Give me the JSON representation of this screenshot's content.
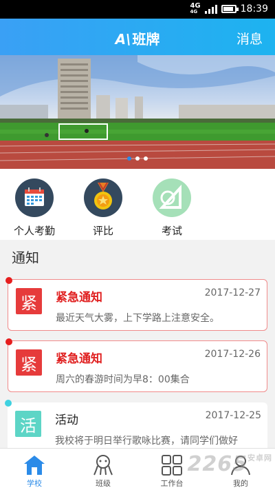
{
  "status_bar": {
    "network": "4G",
    "network_sub": "4G",
    "time": "18:39"
  },
  "header": {
    "logo": "A\\",
    "title": "班牌",
    "messages_label": "消息"
  },
  "banner": {
    "slide_count": 3,
    "active_slide": 1
  },
  "menu": [
    {
      "label": "个人考勤",
      "icon": "calendar-icon"
    },
    {
      "label": "评比",
      "icon": "medal-icon"
    },
    {
      "label": "考试",
      "icon": "ruler-icon"
    }
  ],
  "notices_section": {
    "title": "通知"
  },
  "notices": [
    {
      "badge": "紧",
      "title": "紧急通知",
      "date": "2017-12-27",
      "body": "最近天气大雾，上下学路上注意安全。",
      "accent": "#e63b3b"
    },
    {
      "badge": "紧",
      "title": "紧急通知",
      "date": "2017-12-26",
      "body": "周六的春游时间为早8：00集合",
      "accent": "#e63b3b"
    },
    {
      "badge": "活",
      "title": "活动",
      "date": "2017-12-25",
      "body": "我校将于明日举行歌咏比赛，请同学们做好",
      "accent": "#5dd5c6"
    }
  ],
  "tabs": [
    {
      "label": "学校",
      "icon": "house-icon",
      "active": true
    },
    {
      "label": "班级",
      "icon": "people-icon",
      "active": false
    },
    {
      "label": "工作台",
      "icon": "grid-icon",
      "active": false
    },
    {
      "label": "我的",
      "icon": "person-icon",
      "active": false
    }
  ],
  "watermark": {
    "text": "2265",
    "sub": "安卓网"
  },
  "colors": {
    "primary": "#2b8be8",
    "urgent": "#e63b3b",
    "activity": "#5dd5c6"
  }
}
